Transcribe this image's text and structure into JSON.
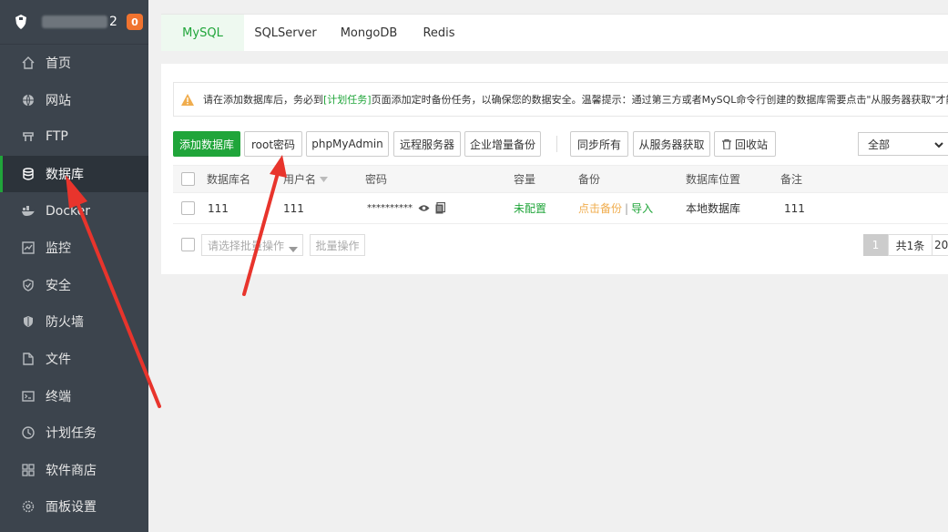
{
  "sidebar": {
    "server_name": "2",
    "badge": "0",
    "items": [
      {
        "label": "首页",
        "icon": "home-icon"
      },
      {
        "label": "网站",
        "icon": "globe-icon"
      },
      {
        "label": "FTP",
        "icon": "ftp-icon"
      },
      {
        "label": "数据库",
        "icon": "database-icon",
        "active": true
      },
      {
        "label": "Docker",
        "icon": "docker-icon"
      },
      {
        "label": "监控",
        "icon": "monitor-icon"
      },
      {
        "label": "安全",
        "icon": "shield-icon"
      },
      {
        "label": "防火墙",
        "icon": "firewall-icon"
      },
      {
        "label": "文件",
        "icon": "folder-icon"
      },
      {
        "label": "终端",
        "icon": "terminal-icon"
      },
      {
        "label": "计划任务",
        "icon": "clock-icon"
      },
      {
        "label": "软件商店",
        "icon": "apps-icon"
      },
      {
        "label": "面板设置",
        "icon": "gear-icon"
      }
    ]
  },
  "tabs": [
    {
      "label": "MySQL",
      "active": true
    },
    {
      "label": "SQLServer"
    },
    {
      "label": "MongoDB"
    },
    {
      "label": "Redis"
    }
  ],
  "tip": {
    "prefix": "请在添加数据库后，务必到",
    "link": "[计划任务]",
    "suffix": "页面添加定时备份任务，以确保您的数据安全。温馨提示：通过第三方或者MySQL命令行创建的数据库需要点击\"从服务器获取\"才能在"
  },
  "toolbar": {
    "add_db": "添加数据库",
    "root_pwd": "root密码",
    "phpmyadmin": "phpMyAdmin",
    "remote_server": "远程服务器",
    "incremental_backup": "企业增量备份",
    "sync_all": "同步所有",
    "fetch_from_server": "从服务器获取",
    "recycle_bin": "回收站",
    "filter_selected": "全部"
  },
  "table": {
    "headers": {
      "name": "数据库名",
      "user": "用户名",
      "password": "密码",
      "capacity": "容量",
      "backup": "备份",
      "location": "数据库位置",
      "note": "备注"
    },
    "rows": [
      {
        "name": "111",
        "user": "111",
        "password": "**********",
        "capacity": "未配置",
        "backup_action": "点击备份",
        "import_action": "导入",
        "location": "本地数据库",
        "note": "111"
      }
    ]
  },
  "footer": {
    "batch_placeholder": "请选择批量操作",
    "batch_button": "批量操作",
    "page_current": "1",
    "page_total": "共1条",
    "page_size": "20"
  },
  "colors": {
    "brand_green": "#20a53a",
    "sidebar_bg": "#3c444d",
    "warning_orange": "#f0ad4e",
    "annotation_red": "#e8342c"
  }
}
